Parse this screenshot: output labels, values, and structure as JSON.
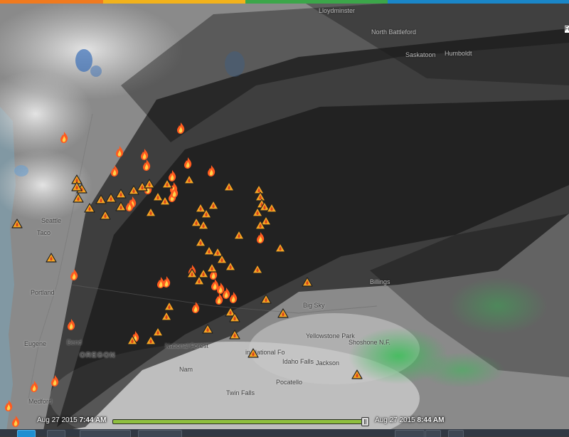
{
  "map": {
    "places": [
      {
        "id": "saskatoon",
        "label": "Saskatoon",
        "tone": "dark"
      },
      {
        "id": "humboldt",
        "label": "Humboldt",
        "tone": "dark"
      },
      {
        "id": "battleford",
        "label": "North Battleford",
        "tone": "dark"
      },
      {
        "id": "lloydminster",
        "label": "Lloydminster",
        "tone": "dark"
      },
      {
        "id": "seattle",
        "label": "Seattle",
        "tone": "light"
      },
      {
        "id": "tacoma",
        "label": "Taco",
        "tone": "light"
      },
      {
        "id": "portland",
        "label": "Portland",
        "tone": "light"
      },
      {
        "id": "eugene",
        "label": "Eugene",
        "tone": "light"
      },
      {
        "id": "bend",
        "label": "Bend",
        "tone": "light"
      },
      {
        "id": "oregon",
        "label": "OREGON",
        "tone": "big"
      },
      {
        "id": "medford",
        "label": "Medford",
        "tone": "light"
      },
      {
        "id": "billings",
        "label": "Billings",
        "tone": "dark"
      },
      {
        "id": "bigsky",
        "label": "Big Sky",
        "tone": "light"
      },
      {
        "id": "yellowstone",
        "label": "Yellowstone Park",
        "tone": "light"
      },
      {
        "id": "shoshone",
        "label": "Shoshone N.F.",
        "tone": "light"
      },
      {
        "id": "jackson",
        "label": "Jackson",
        "tone": "light"
      },
      {
        "id": "idahofalls",
        "label": "Idaho Falls",
        "tone": "light"
      },
      {
        "id": "pocatello",
        "label": "Pocatello",
        "tone": "light"
      },
      {
        "id": "twinfalls",
        "label": "Twin Falls",
        "tone": "light"
      },
      {
        "id": "nampa",
        "label": "Nam",
        "tone": "light"
      },
      {
        "id": "natforest",
        "label": "National Forest",
        "tone": "light"
      },
      {
        "id": "natfor2",
        "label": "in National Fo",
        "tone": "light"
      }
    ],
    "fire_icon": "fire-icon",
    "warning_icon": "warning-icon",
    "fire_count": 33,
    "warning_count": 60
  },
  "timeline": {
    "start_date": "Aug 27 2015",
    "start_time": "7:44 AM",
    "end_date": "Aug 27 2015",
    "end_time": "8:44 AM"
  },
  "edge": {
    "letters": "Fr"
  },
  "colors": {
    "fire": "#ff5a1f",
    "warning": "#f5a623",
    "precip_green": "#3fbf4f",
    "track": "#8fbf3f",
    "play": "#1f8fd1"
  }
}
